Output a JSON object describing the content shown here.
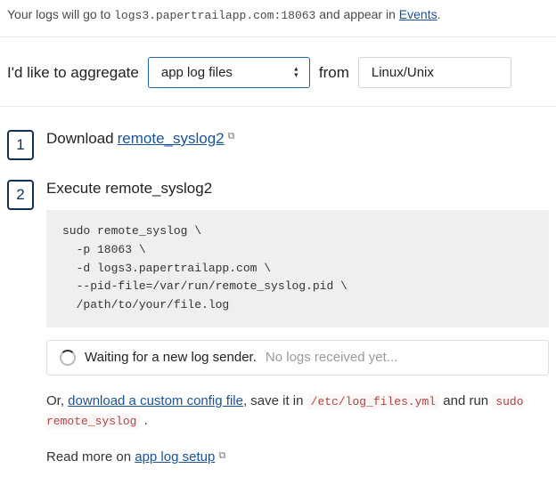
{
  "intro": {
    "prefix": "Your logs will go to ",
    "host": "logs3.papertrailapp.com:18063",
    "middle": " and appear in ",
    "events_link": "Events",
    "suffix": "."
  },
  "controls": {
    "label_pre": "I'd like to aggregate",
    "source_value": "app log files",
    "label_mid": "from",
    "os_value": "Linux/Unix"
  },
  "steps": [
    {
      "num": "1",
      "title_pre": "Download ",
      "title_link": "remote_syslog2"
    },
    {
      "num": "2",
      "title_pre": "Execute remote_syslog2",
      "code": "sudo remote_syslog \\\n  -p 18063 \\\n  -d logs3.papertrailapp.com \\\n  --pid-file=/var/run/remote_syslog.pid \\\n  /path/to/your/file.log"
    }
  ],
  "status": {
    "primary": "Waiting for a new log sender.",
    "secondary": "No logs received yet..."
  },
  "alt": {
    "pre": "Or, ",
    "link": "download a custom config file",
    "mid": ", save it in ",
    "path": "/etc/log_files.yml",
    "post": " and run ",
    "cmd": "sudo remote_syslog",
    "end": " ."
  },
  "readmore": {
    "pre": "Read more on ",
    "link": "app log setup"
  }
}
